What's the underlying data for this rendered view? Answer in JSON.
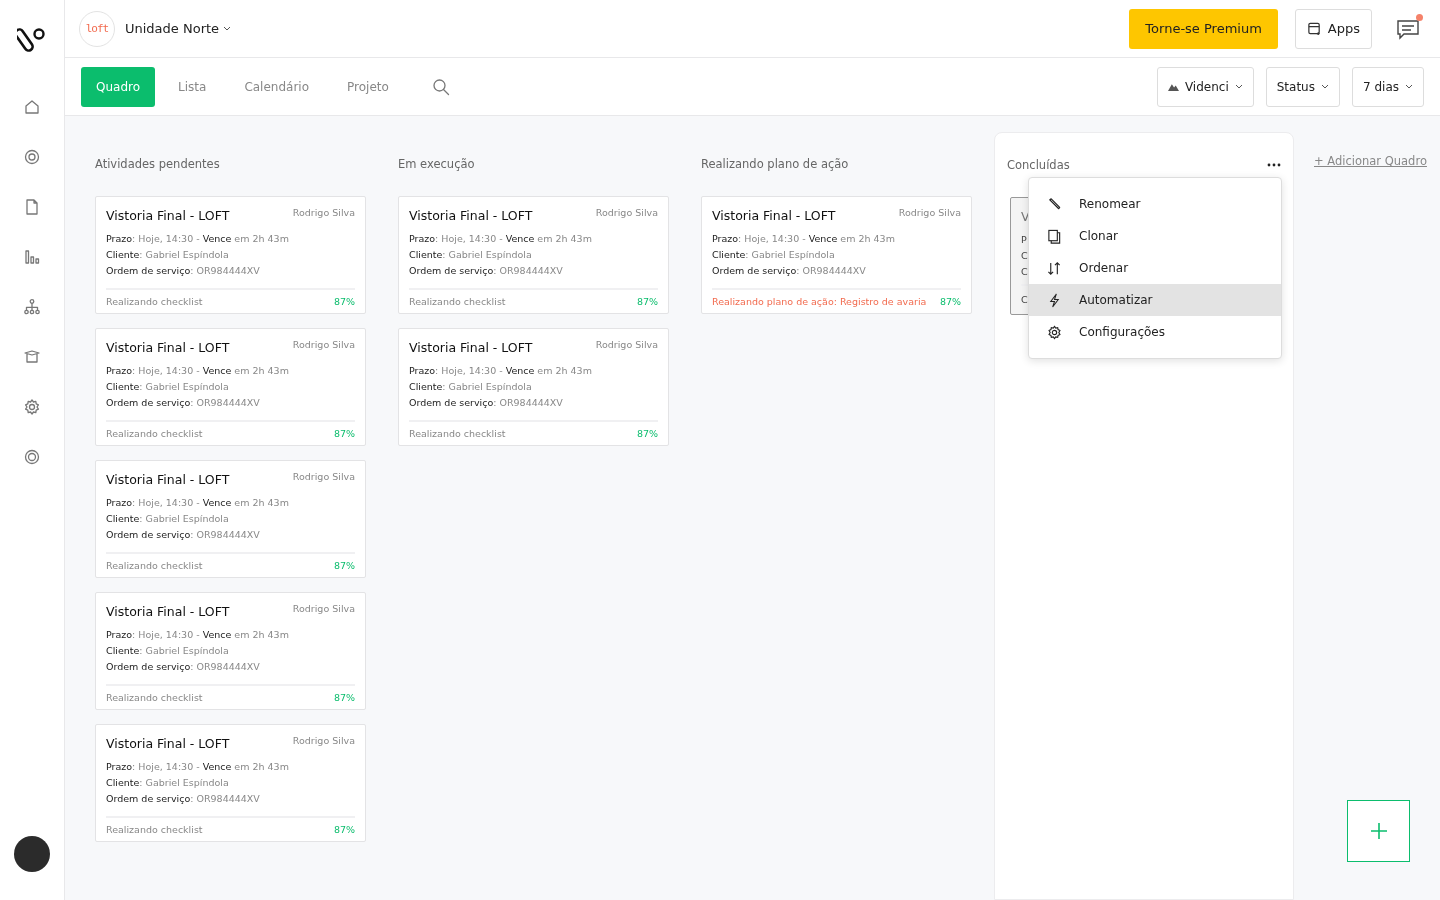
{
  "workspace": {
    "logo_text": "loft",
    "name": "Unidade Norte"
  },
  "header": {
    "premium_button": "Torne-se Premium",
    "apps_button": "Apps",
    "messages_unread": true
  },
  "tabs": [
    {
      "label": "Quadro",
      "selected": true
    },
    {
      "label": "Lista",
      "selected": false
    },
    {
      "label": "Calendário",
      "selected": false
    },
    {
      "label": "Projeto",
      "selected": false
    }
  ],
  "filters": [
    {
      "label": "Videnci",
      "kind": "team"
    },
    {
      "label": "Status",
      "kind": "plain"
    },
    {
      "label": "7 dias",
      "kind": "plain"
    }
  ],
  "columns": [
    {
      "title": "Atividades pendentes",
      "panel": false,
      "cards": [
        {
          "kind": "full",
          "title": "Vistoria Final - LOFT",
          "assignee": "Rodrigo Silva",
          "lines": [
            "**Prazo**: Hoje, 14:30 - **Vence** em 2h 43m",
            "**Cliente**: Gabriel Espíndola",
            "**Ordem de serviço**: OR984444XV"
          ],
          "status": "Realizando checklist",
          "alert": false,
          "progress": "87%"
        },
        {
          "kind": "full",
          "title": "Vistoria Final - LOFT",
          "assignee": "Rodrigo Silva",
          "lines": [
            "**Prazo**: Hoje, 14:30 - **Vence** em 2h 43m",
            "**Cliente**: Gabriel Espíndola",
            "**Ordem de serviço**: OR984444XV"
          ],
          "status": "Realizando checklist",
          "alert": false,
          "progress": "87%"
        },
        {
          "kind": "full",
          "title": "Vistoria Final - LOFT",
          "assignee": "Rodrigo Silva",
          "lines": [
            "**Prazo**: Hoje, 14:30 - **Vence** em 2h 43m",
            "**Cliente**: Gabriel Espíndola",
            "**Ordem de serviço**: OR984444XV"
          ],
          "status": "Realizando checklist",
          "alert": false,
          "progress": "87%"
        },
        {
          "kind": "full",
          "title": "Vistoria Final - LOFT",
          "assignee": "Rodrigo Silva",
          "lines": [
            "**Prazo**: Hoje, 14:30 - **Vence** em 2h 43m",
            "**Cliente**: Gabriel Espíndola",
            "**Ordem de serviço**: OR984444XV"
          ],
          "status": "Realizando checklist",
          "alert": false,
          "progress": "87%"
        },
        {
          "kind": "full",
          "title": "Vistoria Final - LOFT",
          "assignee": "Rodrigo Silva",
          "lines": [
            "**Prazo**: Hoje, 14:30 - **Vence** em 2h 43m",
            "**Cliente**: Gabriel Espíndola",
            "**Ordem de serviço**: OR984444XV"
          ],
          "status": "Realizando checklist",
          "alert": false,
          "progress": "87%"
        }
      ]
    },
    {
      "title": "Em execução",
      "panel": false,
      "cards": [
        {
          "kind": "full",
          "title": "Vistoria Final - LOFT",
          "assignee": "Rodrigo Silva",
          "lines": [
            "**Prazo**: Hoje, 14:30 - **Vence** em 2h 43m",
            "**Cliente**: Gabriel Espíndola",
            "**Ordem de serviço**: OR984444XV"
          ],
          "status": "Realizando checklist",
          "alert": false,
          "progress": "87%"
        },
        {
          "kind": "full",
          "title": "Vistoria Final - LOFT",
          "assignee": "Rodrigo Silva",
          "lines": [
            "**Prazo**: Hoje, 14:30 - **Vence** em 2h 43m",
            "**Cliente**: Gabriel Espíndola",
            "**Ordem de serviço**: OR984444XV"
          ],
          "status": "Realizando checklist",
          "alert": false,
          "progress": "87%"
        }
      ]
    },
    {
      "title": "Realizando plano de ação",
      "panel": false,
      "cards": [
        {
          "kind": "full",
          "title": "Vistoria Final - LOFT",
          "assignee": "Rodrigo Silva",
          "lines": [
            "**Prazo**: Hoje, 14:30 - **Vence** em 2h 43m",
            "**Cliente**: Gabriel Espíndola",
            "**Ordem de serviço**: OR984444XV"
          ],
          "status": "Realizando plano de ação: Registro de avaria",
          "alert": true,
          "progress": "87%"
        }
      ]
    },
    {
      "title": "Concluídas",
      "panel": true,
      "cards": [
        {
          "kind": "covered",
          "title": "V",
          "lines": [
            "P",
            "C",
            "C"
          ],
          "status": "C"
        }
      ],
      "menu": {
        "open": true,
        "items": [
          {
            "label": "Renomear",
            "selected": false
          },
          {
            "label": "Clonar",
            "selected": false
          },
          {
            "label": "Ordenar",
            "selected": false
          },
          {
            "label": "Automatizar",
            "selected": true
          },
          {
            "label": "Configurações",
            "selected": false
          }
        ]
      }
    }
  ],
  "add_board": "+ Adicionar Quadro"
}
